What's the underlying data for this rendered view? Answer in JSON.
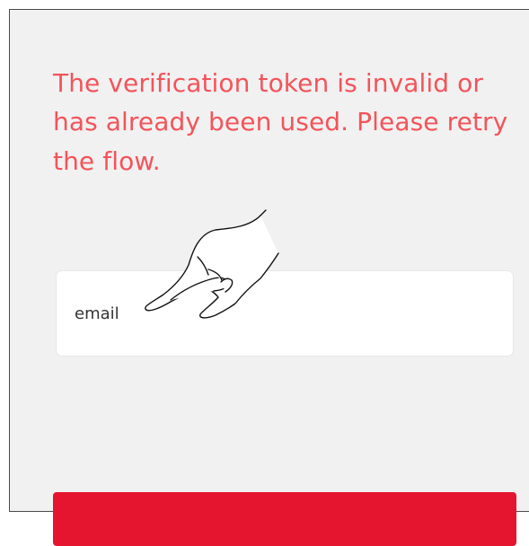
{
  "error": {
    "message": "The verification token is invalid or has already been used. Please retry the flow."
  },
  "email_input": {
    "placeholder": "email",
    "value": ""
  },
  "submit_button": {
    "label": ""
  },
  "cursor": {
    "icon": "hand-pointer-icon"
  },
  "colors": {
    "error": "#f4535a",
    "panel_bg": "#f1f1f1",
    "button": "#e5152f"
  }
}
